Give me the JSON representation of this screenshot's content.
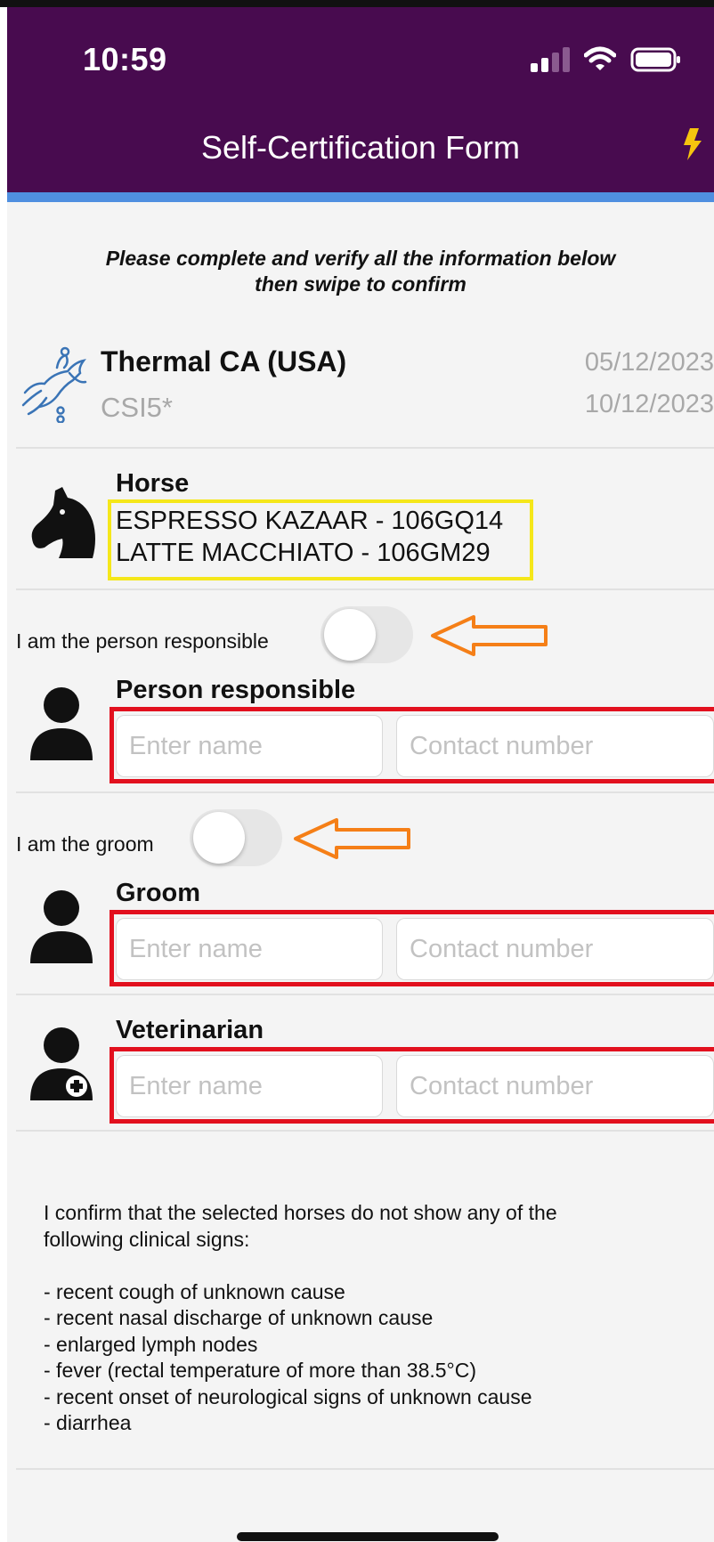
{
  "status_bar": {
    "time": "10:59"
  },
  "header": {
    "title": "Self-Certification Form",
    "accent_color": "#4f8fe0",
    "background_color": "#480b4f",
    "action_icon": "lightning-bolt-icon"
  },
  "instructions": {
    "line1": "Please complete and verify all the information below",
    "line2": "then swipe to confirm"
  },
  "event": {
    "name": "Thermal CA (USA)",
    "level": "CSI5*",
    "start_date": "05/12/2023",
    "end_date": "10/12/2023",
    "icon": "show-jumping-icon"
  },
  "horse": {
    "label": "Horse",
    "entries": [
      "ESPRESSO KAZAAR - 106GQ14",
      "LATTE MACCHIATO - 106GM29"
    ],
    "icon": "horse-head-icon"
  },
  "person_responsible": {
    "toggle_label": "I am the person responsible",
    "toggle_on": false,
    "label": "Person responsible",
    "name_placeholder": "Enter name",
    "contact_placeholder": "Contact number"
  },
  "groom": {
    "toggle_label": "I am the groom",
    "toggle_on": false,
    "label": "Groom",
    "name_placeholder": "Enter name",
    "contact_placeholder": "Contact number"
  },
  "veterinarian": {
    "label": "Veterinarian",
    "name_placeholder": "Enter name",
    "contact_placeholder": "Contact number"
  },
  "confirmation": {
    "intro_line1": "I confirm that the selected horses do not show any of the",
    "intro_line2": "following clinical signs:",
    "signs": [
      "- recent cough of unknown cause",
      "- recent nasal discharge of unknown cause",
      "- enlarged lymph nodes",
      "- fever (rectal temperature of more than 38.5°C)",
      "- recent onset of neurological signs of unknown cause",
      "- diarrhea"
    ]
  },
  "annotations": {
    "highlight_box_color": "#f5e71a",
    "field_box_color": "#e2101e",
    "arrow_color": "#f57f17"
  }
}
